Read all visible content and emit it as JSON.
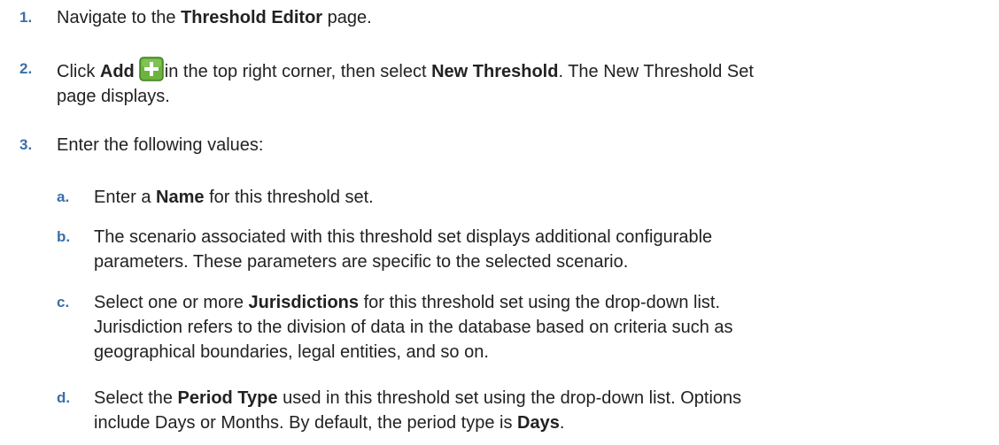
{
  "steps": [
    {
      "num": "1.",
      "a": "Navigate to the ",
      "b": "Threshold Editor",
      "c": " page."
    },
    {
      "num": "2.",
      "a": "Click ",
      "b": "Add",
      "icon": "add-plus-icon",
      "c": "in the top right corner, then select ",
      "d": "New Threshold",
      "e": ". The New Threshold Set",
      "f": "page displays."
    },
    {
      "num": "3.",
      "a": "Enter the following values:"
    }
  ],
  "substeps": [
    {
      "num": "a.",
      "a": "Enter a ",
      "b": "Name",
      "c": " for this threshold set."
    },
    {
      "num": "b.",
      "line1": "The scenario associated with this threshold set displays additional configurable",
      "line2": "parameters. These parameters are specific to the selected scenario."
    },
    {
      "num": "c.",
      "a": "Select one or more ",
      "b": "Jurisdictions",
      "c": " for this threshold set using the drop-down list.",
      "line2": "Jurisdiction refers to the division of data in the database based on criteria such as",
      "line3": "geographical boundaries, legal entities, and so on."
    },
    {
      "num": "d.",
      "a": "Select the ",
      "b": "Period Type",
      "c": " used in this threshold set using the drop-down list. Options",
      "d": "include Days or Months. By default, the period type is ",
      "e": "Days",
      "f": "."
    }
  ],
  "colors": {
    "number": "#3a6fa8",
    "text": "#222222",
    "icon_green": "#6cb33f"
  }
}
